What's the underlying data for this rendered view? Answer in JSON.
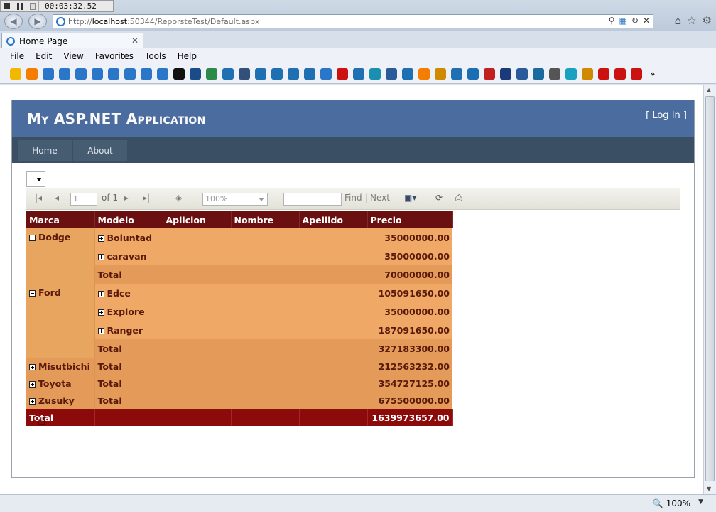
{
  "recorder": {
    "time": "00:03:32.52"
  },
  "browser": {
    "url_prefix": "http://",
    "url_host": "localhost",
    "url_rest": ":50344/ReporsteTest/Default.aspx",
    "tab_title": "Home Page",
    "menu": [
      "File",
      "Edit",
      "View",
      "Favorites",
      "Tools",
      "Help"
    ],
    "zoom_level": "100%",
    "favorites_icons": [
      {
        "icon": "star-icon",
        "color": "#f2b800"
      },
      {
        "icon": "blogger-icon",
        "color": "#f57d00"
      },
      {
        "icon": "ie-icon",
        "color": "#2a77c9"
      },
      {
        "icon": "ie-icon",
        "color": "#2a77c9"
      },
      {
        "icon": "ie-icon",
        "color": "#2a77c9"
      },
      {
        "icon": "ie-icon",
        "color": "#2a77c9"
      },
      {
        "icon": "ie-icon",
        "color": "#2a77c9"
      },
      {
        "icon": "ie-icon",
        "color": "#2a77c9"
      },
      {
        "icon": "ie-icon",
        "color": "#2a77c9"
      },
      {
        "icon": "ie-icon",
        "color": "#2a77c9"
      },
      {
        "icon": "m-icon",
        "color": "#111111"
      },
      {
        "icon": "msl-icon",
        "color": "#1a4c8a"
      },
      {
        "icon": "globe-icon",
        "color": "#2a8a4a"
      },
      {
        "icon": "arrow-icon",
        "color": "#1f6fb3"
      },
      {
        "icon": "news-icon",
        "color": "#33507a"
      },
      {
        "icon": "arrow-icon",
        "color": "#1f6fb3"
      },
      {
        "icon": "arrow-icon",
        "color": "#1f6fb3"
      },
      {
        "icon": "arrow-icon",
        "color": "#1f6fb3"
      },
      {
        "icon": "arrow-icon",
        "color": "#1f6fb3"
      },
      {
        "icon": "ie-icon",
        "color": "#2a77c9"
      },
      {
        "icon": "youtube-icon",
        "color": "#cc1111"
      },
      {
        "icon": "arrow-icon",
        "color": "#1f6fb3"
      },
      {
        "icon": "ss-icon",
        "color": "#1a8fb0"
      },
      {
        "icon": "doc-icon",
        "color": "#2a5a9a"
      },
      {
        "icon": "arrow-icon",
        "color": "#1f6fb3"
      },
      {
        "icon": "blogger-icon",
        "color": "#f57d00"
      },
      {
        "icon": "figure-icon",
        "color": "#d08a00"
      },
      {
        "icon": "arrow-icon",
        "color": "#1f6fb3"
      },
      {
        "icon": "paw-icon",
        "color": "#1a6fb3"
      },
      {
        "icon": "grid-icon",
        "color": "#c02020"
      },
      {
        "icon": "g-icon",
        "color": "#1a3a7a"
      },
      {
        "icon": "doc-icon",
        "color": "#2a5a9a"
      },
      {
        "icon": "a-icon",
        "color": "#1a6aa0"
      },
      {
        "icon": "wiki-icon",
        "color": "#555555"
      },
      {
        "icon": "dots-icon",
        "color": "#1aa0c0"
      },
      {
        "icon": "figure-icon",
        "color": "#d08a00"
      },
      {
        "icon": "youtube-icon",
        "color": "#cc1111"
      },
      {
        "icon": "youtube-icon",
        "color": "#cc1111"
      },
      {
        "icon": "youtube-icon",
        "color": "#cc1111"
      }
    ]
  },
  "site": {
    "title": "My ASP.NET Application",
    "login_prefix": "[ ",
    "login_link": "Log In",
    "login_suffix": " ]",
    "nav": [
      "Home",
      "About"
    ],
    "colors": {
      "header": "#4b6c9e",
      "nav": "#3a4f63",
      "nav_item": "#465c71"
    }
  },
  "report_toolbar": {
    "page_value": "1",
    "of_label": "of 1",
    "zoom_value": "100%",
    "find_label": "Find",
    "separator": "|",
    "next_label": "Next"
  },
  "matrix": {
    "headers": [
      "Marca",
      "Modelo",
      "Aplicion",
      "Nombre",
      "Apellido",
      "Precio"
    ],
    "groups": [
      {
        "marca": "Dodge",
        "expanded": true,
        "models": [
          {
            "name": "Boluntad",
            "precio": "35000000.00"
          },
          {
            "name": "caravan",
            "precio": "35000000.00"
          }
        ],
        "total_label": "Total",
        "total": "70000000.00"
      },
      {
        "marca": "Ford",
        "expanded": true,
        "models": [
          {
            "name": "Edce",
            "precio": "105091650.00"
          },
          {
            "name": "Explore",
            "precio": "35000000.00"
          },
          {
            "name": "Ranger",
            "precio": "187091650.00"
          }
        ],
        "total_label": "Total",
        "total": "327183300.00"
      },
      {
        "marca": "Misutbichi",
        "expanded": false,
        "models": [],
        "total_label": "Total",
        "total": "212563232.00"
      },
      {
        "marca": "Toyota",
        "expanded": false,
        "models": [],
        "total_label": "Total",
        "total": "354727125.00"
      },
      {
        "marca": "Zusuky",
        "expanded": false,
        "models": [],
        "total_label": "Total",
        "total": "675500000.00"
      }
    ],
    "grand_total_label": "Total",
    "grand_total": "1639973657.00",
    "colors": {
      "header": "#6b1010",
      "cell": "#f0a867",
      "subtotal": "#e49a58",
      "grand": "#8b0a0a"
    }
  }
}
